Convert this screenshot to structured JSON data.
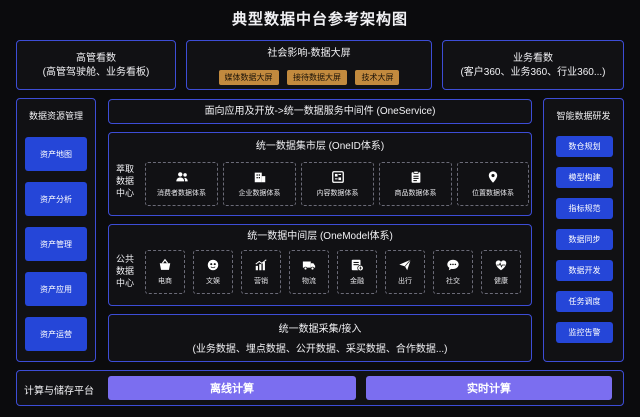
{
  "title": "典型数据中台参考架构图",
  "top": {
    "left": {
      "line1": "高管看数",
      "line2": "(高管驾驶舱、业务看板)"
    },
    "center": {
      "title": "社会影响-数据大屏",
      "tags": [
        "媒体数据大屏",
        "接待数据大屏",
        "技术大屏"
      ]
    },
    "right": {
      "line1": "业务看数",
      "line2": "(客户360、业务360、行业360...)"
    }
  },
  "left_panel": {
    "title": "数据资源管理",
    "items": [
      "资产地图",
      "资产分析",
      "资产管理",
      "资产应用",
      "资产运营"
    ]
  },
  "right_panel": {
    "title": "智能数据研发",
    "items": [
      "数仓规划",
      "模型构建",
      "指标规范",
      "数据同步",
      "数据开发",
      "任务调度",
      "监控告警"
    ]
  },
  "oneservice": "面向应用及开放->统一数据服务中间件 (OneService)",
  "extract": {
    "side": [
      "萃取",
      "数据",
      "中心"
    ],
    "title": "统一数据集市层 (OneID体系)",
    "cells": [
      {
        "label": "消费者数据体系",
        "icon": "people-icon"
      },
      {
        "label": "企业数据体系",
        "icon": "building-icon"
      },
      {
        "label": "内容数据体系",
        "icon": "content-icon"
      },
      {
        "label": "商品数据体系",
        "icon": "clipboard-icon"
      },
      {
        "label": "位置数据体系",
        "icon": "location-icon"
      }
    ]
  },
  "public": {
    "side": [
      "公共",
      "数据",
      "中心"
    ],
    "title": "统一数据中间层 (OneModel体系)",
    "cells": [
      {
        "label": "电商",
        "icon": "basket-icon"
      },
      {
        "label": "文娱",
        "icon": "entertainment-icon"
      },
      {
        "label": "营销",
        "icon": "chart-icon"
      },
      {
        "label": "物流",
        "icon": "truck-icon"
      },
      {
        "label": "金融",
        "icon": "finance-icon"
      },
      {
        "label": "出行",
        "icon": "send-icon"
      },
      {
        "label": "社交",
        "icon": "chat-icon"
      },
      {
        "label": "健康",
        "icon": "heart-icon"
      }
    ]
  },
  "collect": {
    "title": "统一数据采集/接入",
    "sub": "(业务数据、埋点数据、公开数据、采买数据、合作数据...)"
  },
  "bottom": {
    "label": "计算与储存平台",
    "offline": "离线计算",
    "realtime": "实时计算"
  },
  "colors": {
    "accent_border": "#3d4dd6",
    "button_blue": "#2546d8",
    "tag_gold": "#c28a3e",
    "compute_purple": "#7b6ef0"
  }
}
